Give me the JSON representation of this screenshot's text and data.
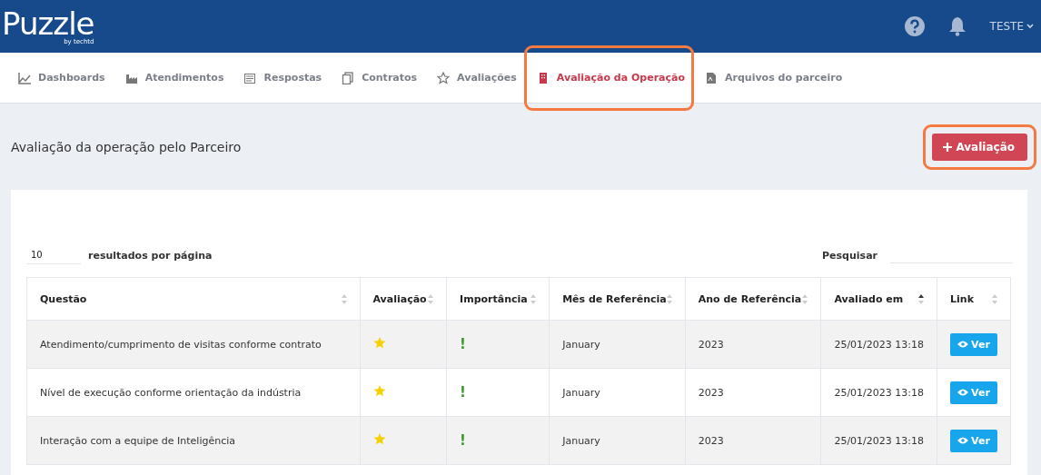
{
  "header": {
    "logo": "Puzzle",
    "logo_sub": "by techtd",
    "user": "TESTE"
  },
  "nav": [
    {
      "label": "Dashboards",
      "selected": false,
      "highlighted": false
    },
    {
      "label": "Atendimentos",
      "selected": false,
      "highlighted": false
    },
    {
      "label": "Respostas",
      "selected": false,
      "highlighted": false
    },
    {
      "label": "Contratos",
      "selected": false,
      "highlighted": false
    },
    {
      "label": "Avaliações",
      "selected": false,
      "highlighted": false
    },
    {
      "label": "Avaliação da Operação",
      "selected": true,
      "highlighted": true
    },
    {
      "label": "Arquivos do parceiro",
      "selected": false,
      "highlighted": false
    }
  ],
  "page": {
    "title": "Avaliação da operação pelo Parceiro",
    "add_button": {
      "label": "Avaliação",
      "highlighted": true
    }
  },
  "table_controls": {
    "page_size": "10",
    "page_size_label": "resultados por página",
    "search_label": "Pesquisar"
  },
  "table": {
    "columns": [
      {
        "label": "Questão",
        "sorted": false
      },
      {
        "label": "Avaliação",
        "sorted": false
      },
      {
        "label": "Importância",
        "sorted": false
      },
      {
        "label": "Mês de Referência",
        "sorted": false
      },
      {
        "label": "Ano de Referência",
        "sorted": false
      },
      {
        "label": "Avaliado em",
        "sorted": true
      },
      {
        "label": "Link",
        "sorted": false
      }
    ],
    "rows": [
      {
        "question": "Atendimento/cumprimento de visitas conforme contrato",
        "importance": "!",
        "month": "January",
        "year": "2023",
        "evaluated": "25/01/2023 13:18",
        "link": "Ver"
      },
      {
        "question": "Nível de execução conforme orientação da indústria",
        "importance": "!",
        "month": "January",
        "year": "2023",
        "evaluated": "25/01/2023 13:18",
        "link": "Ver"
      },
      {
        "question": "Interação com a equipe de Inteligência",
        "importance": "!",
        "month": "January",
        "year": "2023",
        "evaluated": "25/01/2023 13:18",
        "link": "Ver"
      }
    ]
  }
}
